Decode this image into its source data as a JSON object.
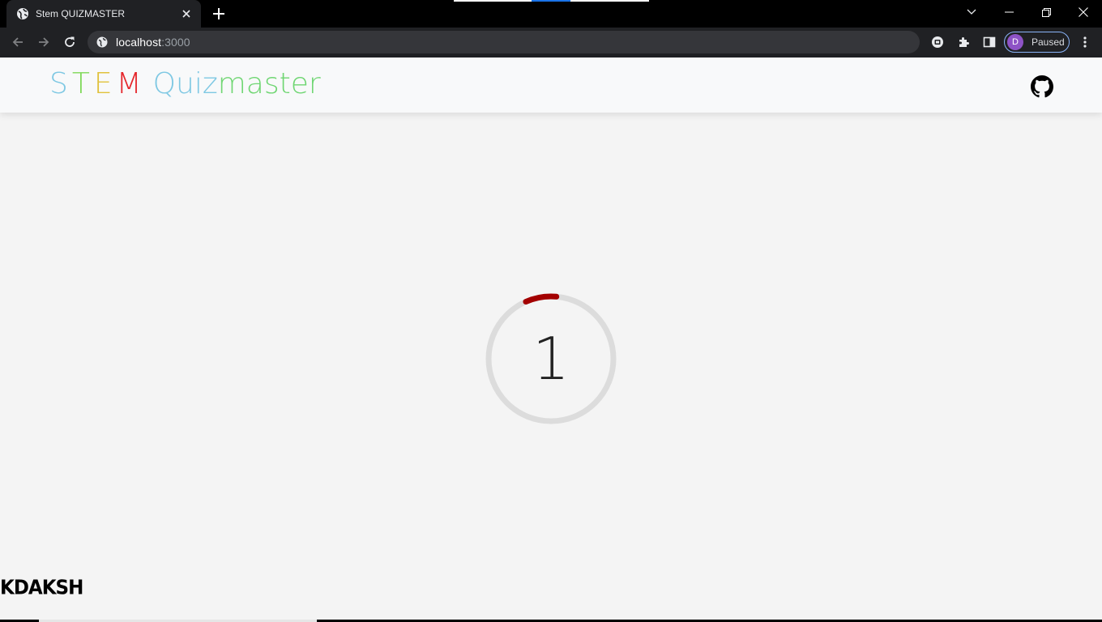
{
  "browser": {
    "tab": {
      "title": "Stem QUIZMASTER",
      "favicon": "globe-icon"
    },
    "address": {
      "host": "localhost",
      "port": ":3000"
    },
    "profile": {
      "initial": "D",
      "status": "Paused"
    }
  },
  "header": {
    "logo": {
      "letters": [
        "S",
        "T",
        "E",
        "M"
      ],
      "word_part1": "Quiz",
      "word_part2": "master"
    }
  },
  "countdown": {
    "value": "1",
    "progress": 0.08
  },
  "footer": {
    "brand": "KDAKSH"
  },
  "colors": {
    "logo_s": "#7ec8e3",
    "logo_t": "#7ed957",
    "logo_e": "#e0c23c",
    "logo_m": "#e5262b",
    "logo_quiz": "#7ec8e3",
    "logo_master": "#6fd672",
    "ring_track": "#dcdcdc",
    "ring_progress": "#a30000"
  }
}
